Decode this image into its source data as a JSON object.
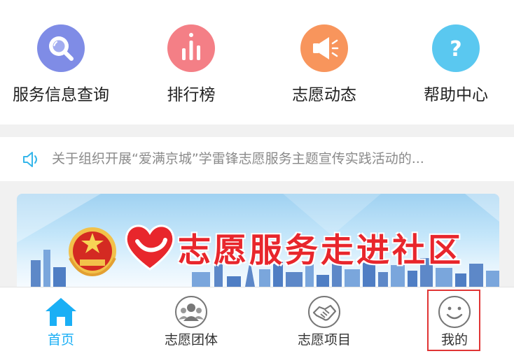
{
  "quick_menu": {
    "items": [
      {
        "label": "服务信息查询",
        "icon": "search-icon",
        "color": "#7f8ce6"
      },
      {
        "label": "排行榜",
        "icon": "ranking-bars-icon",
        "color": "#f47f86"
      },
      {
        "label": "志愿动态",
        "icon": "megaphone-icon",
        "color": "#f8955c"
      },
      {
        "label": "帮助中心",
        "icon": "help-question-icon",
        "color": "#5ac8f0"
      }
    ]
  },
  "notice": {
    "icon": "speaker-icon",
    "text": "关于组织开展“爱满京城”学雷锋志愿服务主题宣传实践活动的..."
  },
  "banner": {
    "title": "志愿服务走进社区",
    "title_color": "#e8262c"
  },
  "tabbar": {
    "active_color": "#1aaff5",
    "highlight_color": "#e03535",
    "tabs": [
      {
        "label": "首页",
        "icon": "home-icon",
        "active": true
      },
      {
        "label": "志愿团体",
        "icon": "group-icon",
        "active": false
      },
      {
        "label": "志愿项目",
        "icon": "handshake-icon",
        "active": false
      },
      {
        "label": "我的",
        "icon": "smiley-icon",
        "active": false,
        "highlighted": true
      }
    ]
  }
}
